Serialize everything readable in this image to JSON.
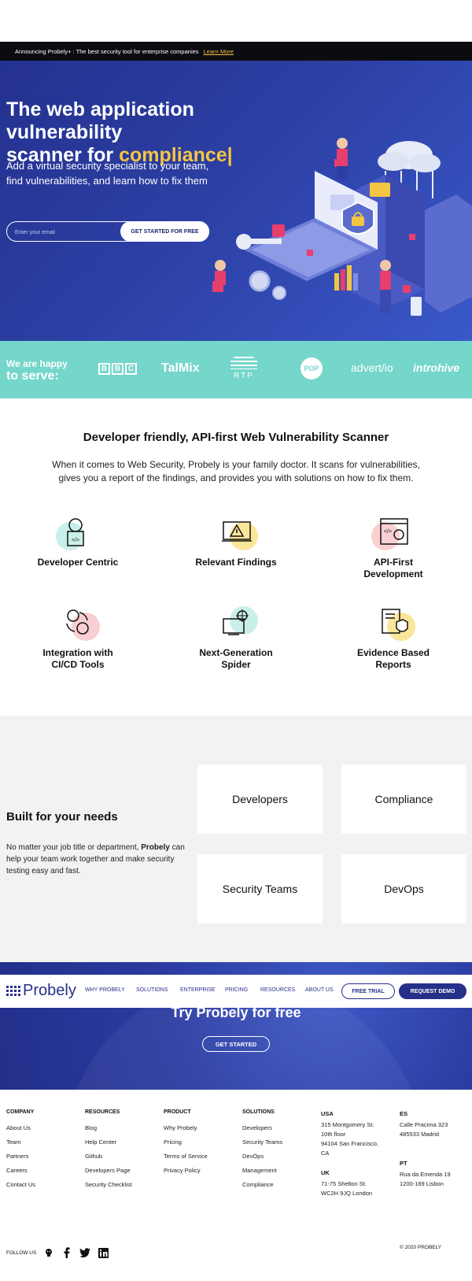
{
  "announcement": {
    "text": "Announcing Probely+ : The best security tool for enterprise companies",
    "link": "Learn More"
  },
  "hero": {
    "title_line1": "The web application vulnerability",
    "title_line2": "scanner for ",
    "title_accent": "compliance|",
    "subtitle": "Add a virtual security specialist to your team, find vulnerabilities, and learn how to fix them",
    "email_placeholder": "Enter your email",
    "cta": "GET STARTED FOR FREE"
  },
  "clients": {
    "lead_line1": "We are happy",
    "lead_line2": "to serve:",
    "logos": {
      "bbc": [
        "B",
        "B",
        "C"
      ],
      "talmix": "TalMix",
      "rtp": "RTP",
      "pop": "POP",
      "advertio": "advert/io",
      "introhive": "introhive"
    }
  },
  "features": {
    "title": "Developer friendly, API-first Web Vulnerability Scanner",
    "description": "When it comes to Web Security, Probely is your family doctor. It scans for vulnerabilities, gives you a report of the findings, and provides you with solutions on how to fix them.",
    "items": [
      {
        "line1": "Developer Centric",
        "line2": "",
        "blob": "#c9efe9"
      },
      {
        "line1": "Relevant Findings",
        "line2": "",
        "blob": "#fbe59a"
      },
      {
        "line1": "API-First",
        "line2": "Development",
        "blob": "#f9cfd2"
      },
      {
        "line1": "Integration with",
        "line2": "CI/CD Tools",
        "blob": "#f9cfd2"
      },
      {
        "line1": "Next-Generation",
        "line2": "Spider",
        "blob": "#c9efe9"
      },
      {
        "line1": "Evidence Based",
        "line2": "Reports",
        "blob": "#fbe59a"
      }
    ]
  },
  "needs": {
    "title": "Built for your needs",
    "desc_before": "No matter your job title or department, ",
    "desc_brand": "Probely",
    "desc_after": " can help your team work together and make security testing easy and fast.",
    "cards": [
      "Developers",
      "Compliance",
      "Security Teams",
      "DevOps"
    ]
  },
  "cta": {
    "title": "Try Probely for free",
    "button": "GET STARTED"
  },
  "nav": {
    "brand": "Probely",
    "items": [
      "WHY PROBELY",
      "SOLUTIONS",
      "ENTERPRISE",
      "PRICING",
      "RESOURCES",
      "ABOUT US"
    ],
    "free_trial": "FREE TRIAL",
    "request_demo": "REQUEST DEMO"
  },
  "footer": {
    "columns": [
      {
        "heading": "COMPANY",
        "links": [
          "About Us",
          "Team",
          "Partners",
          "Careers",
          "Contact Us"
        ]
      },
      {
        "heading": "RESOURCES",
        "links": [
          "Blog",
          "Help Center",
          "Github",
          "Developers Page",
          "Security Checklist"
        ]
      },
      {
        "heading": "PRODUCT",
        "links": [
          "Why Probely",
          "Pricing",
          "Terms of Service",
          "Privacy Policy"
        ]
      },
      {
        "heading": "SOLUTIONS",
        "links": [
          "Developers",
          "Security Teams",
          "DevOps",
          "Management",
          "Compliance"
        ]
      }
    ],
    "addresses": {
      "usa": {
        "heading": "USA",
        "lines": [
          "315 Montgomery St.",
          "10th floor",
          "94104 San Francisco,",
          "CA"
        ]
      },
      "uk": {
        "heading": "UK",
        "lines": [
          "71-75 Shelton St.",
          "WC2H 9JQ London"
        ]
      },
      "es": {
        "heading": "ES",
        "lines": [
          "Calle Pracima 323",
          "485533 Madrid"
        ]
      },
      "pt": {
        "heading": "PT",
        "lines": [
          "Rua da Emenda 19",
          "1200-169 Lisbon"
        ]
      }
    },
    "follow": "FOLLOW US",
    "social_icons": [
      "github-icon",
      "facebook-icon",
      "twitter-icon",
      "linkedin-icon"
    ],
    "copyright": "© 2020 PROBELY"
  },
  "colors": {
    "brand_navy": "#263088",
    "accent_yellow": "#f4c542",
    "teal_band": "#75d6cb",
    "hero_blue": "#2c3fa3"
  }
}
